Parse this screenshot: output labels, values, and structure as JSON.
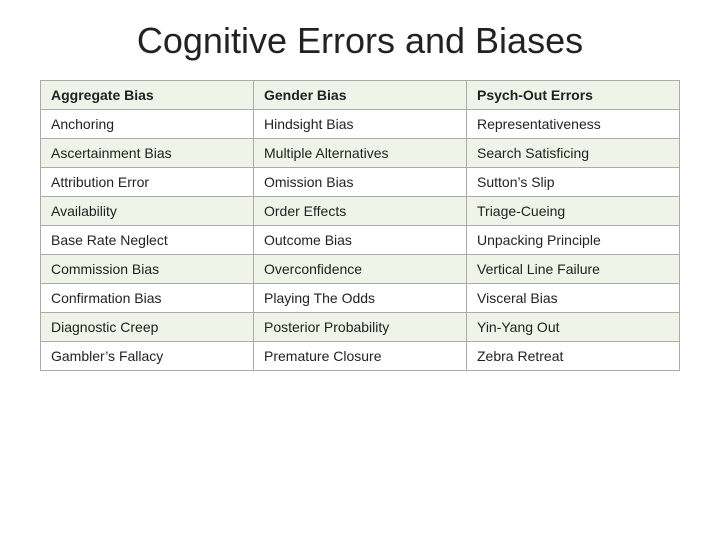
{
  "title": "Cognitive Errors and Biases",
  "table": {
    "rows": [
      [
        "Aggregate Bias",
        "Gender Bias",
        "Psych-Out Errors"
      ],
      [
        "Anchoring",
        "Hindsight Bias",
        "Representativeness"
      ],
      [
        "Ascertainment Bias",
        "Multiple Alternatives",
        "Search Satisficing"
      ],
      [
        "Attribution Error",
        "Omission Bias",
        "Sutton’s Slip"
      ],
      [
        "Availability",
        "Order Effects",
        "Triage-Cueing"
      ],
      [
        "Base Rate Neglect",
        "Outcome Bias",
        "Unpacking Principle"
      ],
      [
        "Commission Bias",
        "Overconfidence",
        "Vertical Line Failure"
      ],
      [
        "Confirmation Bias",
        "Playing The Odds",
        "Visceral Bias"
      ],
      [
        "Diagnostic Creep",
        "Posterior Probability",
        "Yin-Yang Out"
      ],
      [
        "Gambler’s Fallacy",
        "Premature Closure",
        "Zebra Retreat"
      ]
    ]
  }
}
